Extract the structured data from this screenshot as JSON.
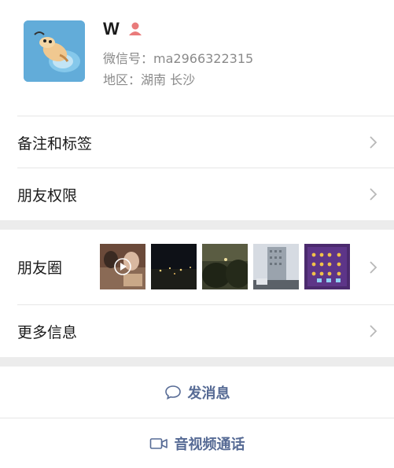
{
  "profile": {
    "name": "W",
    "wechat_id_label": "微信号：",
    "wechat_id": "ma2966322315",
    "region_label": "地区：",
    "region": "湖南 长沙"
  },
  "menu": {
    "remarks": "备注和标签",
    "friend_permissions": "朋友权限",
    "moments": "朋友圈",
    "more_info": "更多信息"
  },
  "actions": {
    "send_message": "发消息",
    "av_call": "音视频通话"
  },
  "icons": {
    "gender": "female-person-icon",
    "chevron": "chevron-right-icon",
    "message": "chat-bubble-icon",
    "video": "video-camera-icon",
    "play": "play-icon"
  },
  "colors": {
    "link_blue": "#576b95",
    "gender_pink": "#e97b7b",
    "section_gap": "#ececec"
  }
}
